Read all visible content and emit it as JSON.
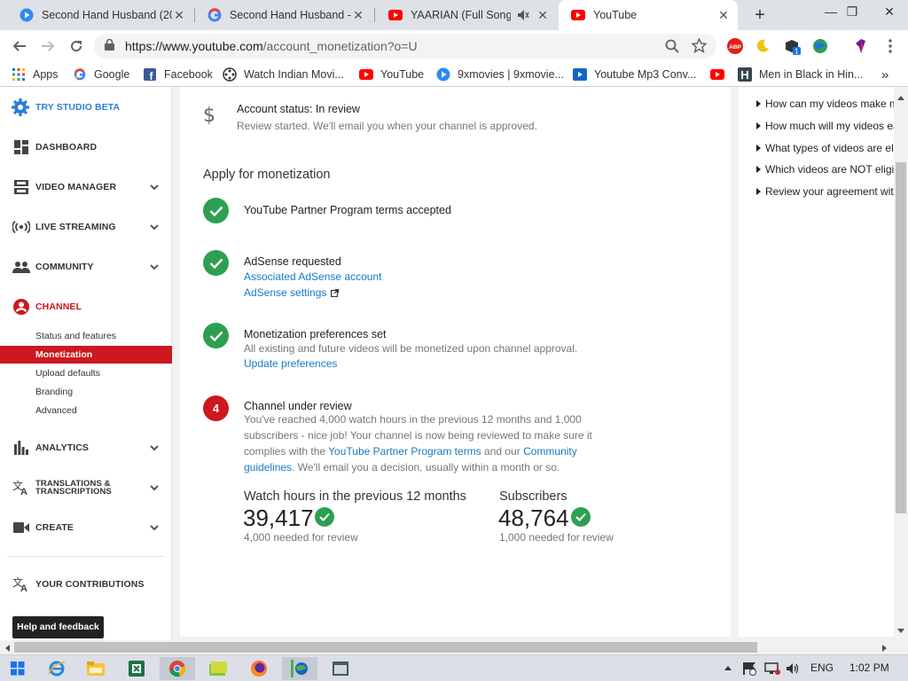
{
  "browser": {
    "tabs": [
      {
        "label": "Second Hand Husband (20",
        "icon": "play-icon"
      },
      {
        "label": "Second Hand Husband - G",
        "icon": "google-icon"
      },
      {
        "label": "YAARIAN (Full Song) |",
        "icon": "youtube-icon"
      },
      {
        "label": "YouTube",
        "icon": "youtube-icon"
      }
    ],
    "url_prefix": "https://www.youtube.com",
    "url_path": "/account_monetization?o=U",
    "bookmarks": [
      {
        "label": "Apps"
      },
      {
        "label": "Google"
      },
      {
        "label": "Facebook"
      },
      {
        "label": "Watch Indian Movi..."
      },
      {
        "label": "YouTube"
      },
      {
        "label": "9xmovies | 9xmovie..."
      },
      {
        "label": "Youtube Mp3 Conv..."
      },
      {
        "label": "Men in Black in Hin..."
      }
    ],
    "colors": {
      "accent_red": "#cc181e",
      "success_green": "#2e9f52",
      "link_blue": "#167ac6"
    }
  },
  "sidebar": {
    "try_studio": "TRY STUDIO BETA",
    "dashboard": "DASHBOARD",
    "video_manager": "VIDEO MANAGER",
    "live_streaming": "LIVE STREAMING",
    "community": "COMMUNITY",
    "channel": "CHANNEL",
    "channel_items": [
      "Status and features",
      "Monetization",
      "Upload defaults",
      "Branding",
      "Advanced"
    ],
    "analytics": "ANALYTICS",
    "translations_1": "TRANSLATIONS &",
    "translations_2": "TRANSCRIPTIONS",
    "create": "CREATE",
    "contributions": "YOUR CONTRIBUTIONS",
    "help": "Help and feedback"
  },
  "main": {
    "account_status": "Account status: In review",
    "account_status_sub": "Review started. We'll email you when your channel is approved.",
    "section_title": "Apply for monetization",
    "steps": [
      {
        "title": "YouTube Partner Program terms accepted"
      },
      {
        "title": "AdSense requested",
        "link1": "Associated AdSense account",
        "link2": "AdSense settings"
      },
      {
        "title": "Monetization preferences set",
        "text": "All existing and future videos will be monetized upon channel approval.",
        "link1": "Update preferences"
      },
      {
        "number": "4",
        "title": "Channel under review",
        "para_1": "You've reached 4,000 watch hours in the previous 12 months and 1,000 subscribers - nice job! Your channel is now being reviewed to make sure it complies with the ",
        "para_link1": "YouTube Partner Program terms",
        "para_2": " and our ",
        "para_link2": "Community guidelines",
        "para_3": ". We'll email you a decision, usually within a month or so."
      }
    ],
    "stats": [
      {
        "label": "Watch hours in the previous 12 months",
        "value": "39,417",
        "note": "4,000 needed for review"
      },
      {
        "label": "Subscribers",
        "value": "48,764",
        "note": "1,000 needed for review"
      }
    ]
  },
  "help_panel": {
    "items": [
      "How can my videos make m",
      "How much will my videos ea",
      "What types of videos are eli",
      "Which videos are NOT eligib",
      "Review your agreement with"
    ]
  },
  "taskbar": {
    "language": "ENG",
    "time": "1:02 PM"
  }
}
